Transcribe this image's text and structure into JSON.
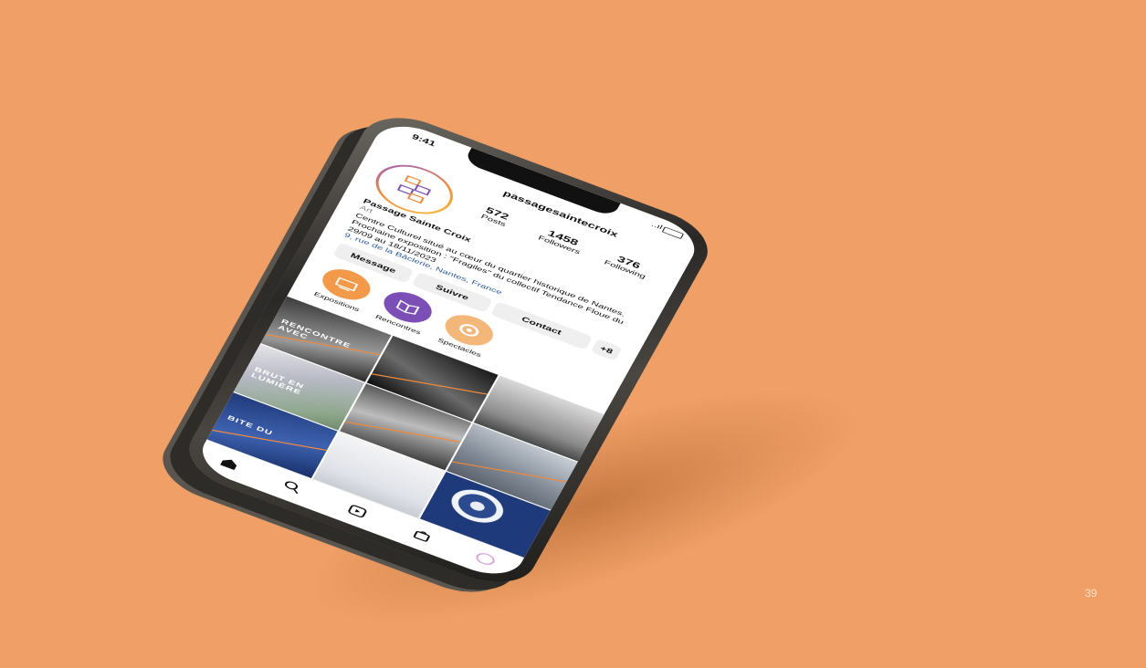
{
  "page_number": "39",
  "status_bar": {
    "time": "9:41",
    "signal": "..ıl"
  },
  "profile": {
    "username": "passagesaintecroix",
    "name": "Passage Sainte Croix",
    "category": "Art",
    "bio_lines": [
      "Centre Culturel situé au cœur du quartier historique de Nantes.",
      "Prochaine exposition : \"Fragiles\" du collectif Tendance Floue du",
      "29/09 au 18/11/2023"
    ],
    "address": "9, rue de la Bâclerie, Nantes, France",
    "stats": [
      {
        "value": "572",
        "label": "Posts"
      },
      {
        "value": "1458",
        "label": "Followers"
      },
      {
        "value": "376",
        "label": "Following"
      }
    ]
  },
  "buttons": {
    "message": "Message",
    "follow": "Suivre",
    "contact": "Contact",
    "more": "+8"
  },
  "highlights": [
    {
      "label": "Expositions",
      "color": "#f29a4a"
    },
    {
      "label": "Rencontres",
      "color": "#7b4fb5"
    },
    {
      "label": "Spectacles",
      "color": "#f4b77a"
    }
  ],
  "grid_overlays": {
    "c1": "RENCONTRE AVEC",
    "c4": "BRUT EN LUMIÈRE",
    "c7": "BITE DU"
  },
  "colors": {
    "background": "#f0a066",
    "accent_orange": "#f08a3c",
    "accent_purple": "#7b4fb5",
    "link_blue": "#2f5f9e"
  },
  "tabbar_icons": [
    "home-icon",
    "search-icon",
    "reels-icon",
    "shop-icon",
    "profile-icon"
  ]
}
